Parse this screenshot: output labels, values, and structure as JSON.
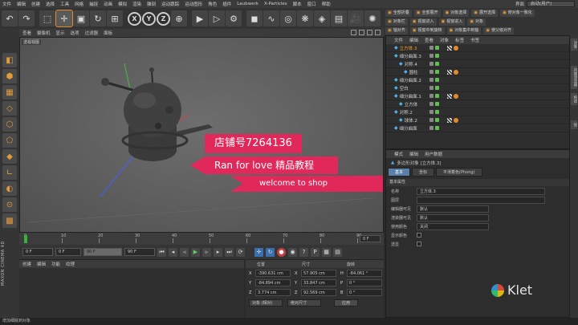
{
  "menubar": {
    "items": [
      "文件",
      "编辑",
      "创建",
      "选择",
      "工具",
      "网格",
      "捕捉",
      "动画",
      "模拟",
      "渲染",
      "雕刻",
      "运动跟踪",
      "运动图形",
      "角色",
      "插件",
      "Laubwerk",
      "X-Particles",
      "脚本",
      "窗口",
      "帮助"
    ],
    "layout_label": "界面",
    "layout_value": "启动(用户)"
  },
  "right_tools": {
    "row1": [
      "全部折叠",
      "全部展开",
      "对象选择",
      "展开选择",
      "使对象一致化"
    ],
    "row2": [
      "对象栏",
      "视窗进入",
      "视窗进入",
      "对象"
    ],
    "row3": [
      "轴对齐",
      "视窗中到旋转",
      "对象集中到轴",
      "使父级对齐"
    ]
  },
  "viewport": {
    "menu": [
      "查看",
      "摄像机",
      "显示",
      "选项",
      "过滤器",
      "面板"
    ],
    "label": "透视视图"
  },
  "banners": {
    "shop": "店铺号7264136",
    "course": "Ran for love 精品教程",
    "welcome": "welcome to shop"
  },
  "timeline": {
    "ticks": [
      "0",
      "10",
      "20",
      "30",
      "40",
      "50",
      "60",
      "70",
      "80",
      "90"
    ],
    "current_frame": "0 F"
  },
  "transport": {
    "start": "0 F",
    "current": "0 F",
    "end": "90 F",
    "preview_end": "90 F"
  },
  "material_manager": {
    "menu": [
      "创建",
      "编辑",
      "功能",
      "纹理"
    ]
  },
  "coordinates": {
    "headers": [
      "位置",
      "尺寸",
      "旋转"
    ],
    "rows": [
      {
        "axis": "X",
        "pos": "-390.631 cm",
        "size_axis": "X",
        "size": "57.905 cm",
        "rot_axis": "H",
        "rot": "-84.061 °"
      },
      {
        "axis": "Y",
        "pos": "-84.894 cm",
        "size_axis": "Y",
        "size": "33.847 cm",
        "rot_axis": "P",
        "rot": "0 °"
      },
      {
        "axis": "Z",
        "pos": "3.774 cm",
        "size_axis": "Z",
        "size": "92.569 cm",
        "rot_axis": "B",
        "rot": "0 °"
      }
    ],
    "mode_select": "对象 (相对)",
    "size_select": "绝对尺寸",
    "apply_label": "应用"
  },
  "status_text": "增加细腻到对象",
  "object_manager": {
    "menu": [
      "文件",
      "编辑",
      "查看",
      "对象",
      "标签",
      "书签"
    ],
    "objects": [
      {
        "name": "立方体.3",
        "indent": 1,
        "selected": true
      },
      {
        "name": "细分曲面.3",
        "indent": 1,
        "selected": false
      },
      {
        "name": "对称.4",
        "indent": 2,
        "selected": false
      },
      {
        "name": "圆柱",
        "indent": 3,
        "selected": false
      },
      {
        "name": "细分曲面.2",
        "indent": 1,
        "selected": false
      },
      {
        "name": "空白",
        "indent": 1,
        "selected": false
      },
      {
        "name": "细分曲面.1",
        "indent": 1,
        "selected": false
      },
      {
        "name": "立方体",
        "indent": 2,
        "selected": false
      },
      {
        "name": "对称.2",
        "indent": 1,
        "selected": false
      },
      {
        "name": "球体.2",
        "indent": 2,
        "selected": false
      },
      {
        "name": "细分曲面",
        "indent": 1,
        "selected": false
      }
    ]
  },
  "attribute_manager": {
    "menu": [
      "模式",
      "编辑",
      "用户数据"
    ],
    "title": "多边形对象 [立方体.3]",
    "tabs": [
      "基本",
      "坐标",
      "平滑着色(Phong)"
    ],
    "section": "基本属性",
    "fields": [
      {
        "label": "名称",
        "value": "立方体.3"
      },
      {
        "label": "图层",
        "value": ""
      },
      {
        "label": "编辑器可见",
        "value": "默认"
      },
      {
        "label": "渲染器可见",
        "value": "默认"
      },
      {
        "label": "使用颜色",
        "value": "关闭"
      },
      {
        "label": "显示颜色",
        "value": ""
      },
      {
        "label": "透显",
        "value": ""
      }
    ]
  },
  "vtabs": [
    "对象",
    "内容浏览器",
    "构造",
    "层"
  ],
  "branding": {
    "maxon": "MAXON CINEMA 4D",
    "klet": "Klet"
  },
  "colors": {
    "banner": "#e0285a",
    "accent": "#e08a2a",
    "selected_tab": "#5b7fa8"
  }
}
